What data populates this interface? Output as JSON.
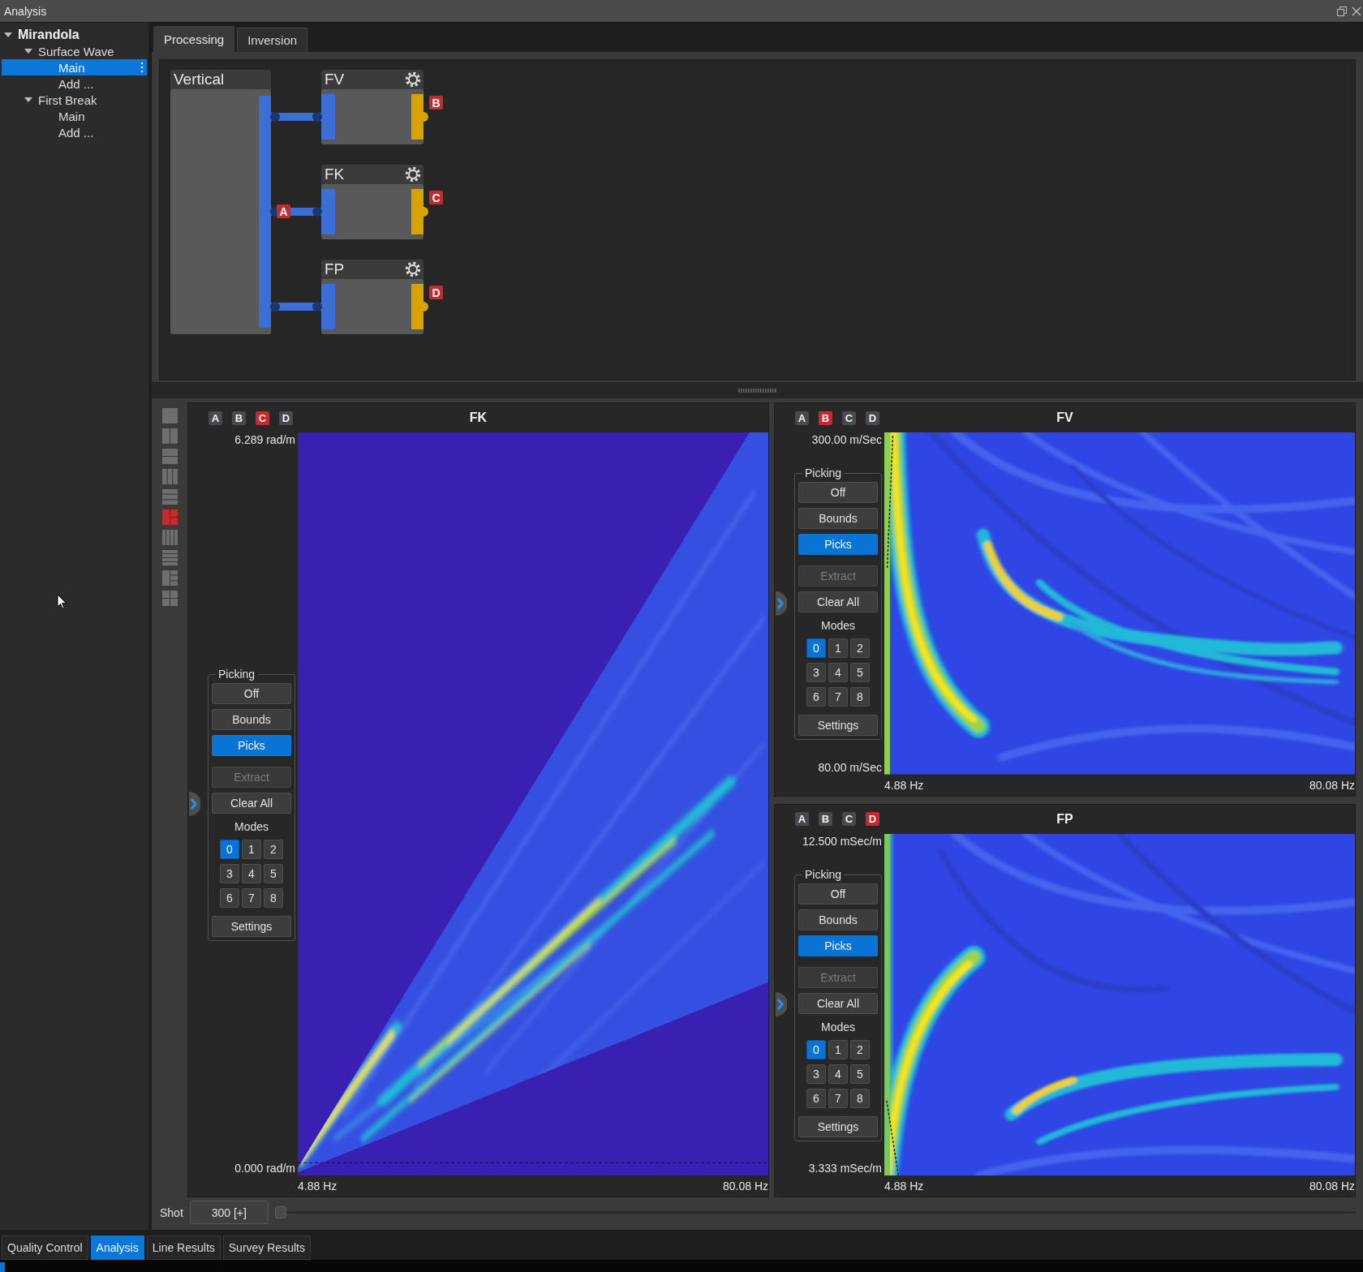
{
  "window": {
    "title": "Analysis"
  },
  "tree": [
    {
      "label": "Mirandola",
      "expanded": true,
      "selected": false,
      "children": [
        {
          "label": "Surface Wave",
          "expanded": true,
          "selected": false,
          "children": [
            {
              "label": "Main",
              "selected": true
            },
            {
              "label": "Add ...",
              "selected": false
            }
          ]
        },
        {
          "label": "First Break",
          "expanded": true,
          "selected": false,
          "children": [
            {
              "label": "Main",
              "selected": false
            },
            {
              "label": "Add ...",
              "selected": false
            }
          ]
        }
      ]
    }
  ],
  "tabs": [
    {
      "label": "Processing",
      "selected": true
    },
    {
      "label": "Inversion",
      "selected": false
    }
  ],
  "graph": {
    "source": {
      "title": "Vertical",
      "output": "A"
    },
    "nodes": [
      {
        "title": "FV",
        "output": "B"
      },
      {
        "title": "FK",
        "output": "C"
      },
      {
        "title": "FP",
        "output": "D"
      }
    ]
  },
  "layouts": [
    {
      "kind": "single",
      "selected": false
    },
    {
      "kind": "cols2",
      "selected": false
    },
    {
      "kind": "rows2",
      "selected": false
    },
    {
      "kind": "cols3",
      "selected": false
    },
    {
      "kind": "rows3",
      "selected": false
    },
    {
      "kind": "left2",
      "selected": true
    },
    {
      "kind": "cols4",
      "selected": false
    },
    {
      "kind": "rows4",
      "selected": false
    },
    {
      "kind": "left3",
      "selected": false
    },
    {
      "kind": "grid4",
      "selected": false
    }
  ],
  "plots": [
    {
      "kind": "fk",
      "title": "FK",
      "sources": [
        {
          "label": "A",
          "selected": false
        },
        {
          "label": "B",
          "selected": false
        },
        {
          "label": "C",
          "selected": true
        },
        {
          "label": "D",
          "selected": false
        }
      ],
      "y_max": "6.289 rad/m",
      "y_min": "0.000 rad/m",
      "x_min": "4.88 Hz",
      "x_max": "80.08 Hz",
      "picking": {
        "title": "Picking",
        "options": [
          {
            "label": "Off",
            "selected": false
          },
          {
            "label": "Bounds",
            "selected": false
          },
          {
            "label": "Picks",
            "selected": true
          }
        ],
        "actions": [
          {
            "label": "Extract",
            "disabled": true
          },
          {
            "label": "Clear All",
            "disabled": false
          }
        ],
        "modes_title": "Modes",
        "modes": [
          {
            "label": "0",
            "selected": true
          },
          {
            "label": "1",
            "selected": false
          },
          {
            "label": "2",
            "selected": false
          },
          {
            "label": "3",
            "selected": false
          },
          {
            "label": "4",
            "selected": false
          },
          {
            "label": "5",
            "selected": false
          },
          {
            "label": "6",
            "selected": false
          },
          {
            "label": "7",
            "selected": false
          },
          {
            "label": "8",
            "selected": false
          }
        ],
        "settings": "Settings"
      }
    },
    {
      "kind": "fv",
      "title": "FV",
      "sources": [
        {
          "label": "A",
          "selected": false
        },
        {
          "label": "B",
          "selected": true
        },
        {
          "label": "C",
          "selected": false
        },
        {
          "label": "D",
          "selected": false
        }
      ],
      "y_max": "300.00 m/Sec",
      "y_min": "80.00 m/Sec",
      "x_min": "4.88 Hz",
      "x_max": "80.08 Hz",
      "picking": {
        "title": "Picking",
        "options": [
          {
            "label": "Off",
            "selected": false
          },
          {
            "label": "Bounds",
            "selected": false
          },
          {
            "label": "Picks",
            "selected": true
          }
        ],
        "actions": [
          {
            "label": "Extract",
            "disabled": true
          },
          {
            "label": "Clear All",
            "disabled": false
          }
        ],
        "modes_title": "Modes",
        "modes": [
          {
            "label": "0",
            "selected": true
          },
          {
            "label": "1",
            "selected": false
          },
          {
            "label": "2",
            "selected": false
          },
          {
            "label": "3",
            "selected": false
          },
          {
            "label": "4",
            "selected": false
          },
          {
            "label": "5",
            "selected": false
          },
          {
            "label": "6",
            "selected": false
          },
          {
            "label": "7",
            "selected": false
          },
          {
            "label": "8",
            "selected": false
          }
        ],
        "settings": "Settings"
      }
    },
    {
      "kind": "fp",
      "title": "FP",
      "sources": [
        {
          "label": "A",
          "selected": false
        },
        {
          "label": "B",
          "selected": false
        },
        {
          "label": "C",
          "selected": false
        },
        {
          "label": "D",
          "selected": true
        }
      ],
      "y_max": "12.500 mSec/m",
      "y_min": "3.333 mSec/m",
      "x_min": "4.88 Hz",
      "x_max": "80.08 Hz",
      "picking": {
        "title": "Picking",
        "options": [
          {
            "label": "Off",
            "selected": false
          },
          {
            "label": "Bounds",
            "selected": false
          },
          {
            "label": "Picks",
            "selected": true
          }
        ],
        "actions": [
          {
            "label": "Extract",
            "disabled": true
          },
          {
            "label": "Clear All",
            "disabled": false
          }
        ],
        "modes_title": "Modes",
        "modes": [
          {
            "label": "0",
            "selected": true
          },
          {
            "label": "1",
            "selected": false
          },
          {
            "label": "2",
            "selected": false
          },
          {
            "label": "3",
            "selected": false
          },
          {
            "label": "4",
            "selected": false
          },
          {
            "label": "5",
            "selected": false
          },
          {
            "label": "6",
            "selected": false
          },
          {
            "label": "7",
            "selected": false
          },
          {
            "label": "8",
            "selected": false
          }
        ],
        "settings": "Settings"
      }
    }
  ],
  "shot": {
    "label": "Shot",
    "value": "300 [+]",
    "level": 0
  },
  "bottom_tabs": [
    {
      "label": "Quality Control",
      "selected": false
    },
    {
      "label": "Analysis",
      "selected": true
    },
    {
      "label": "Line Results",
      "selected": false
    },
    {
      "label": "Survey Results",
      "selected": false
    }
  ]
}
